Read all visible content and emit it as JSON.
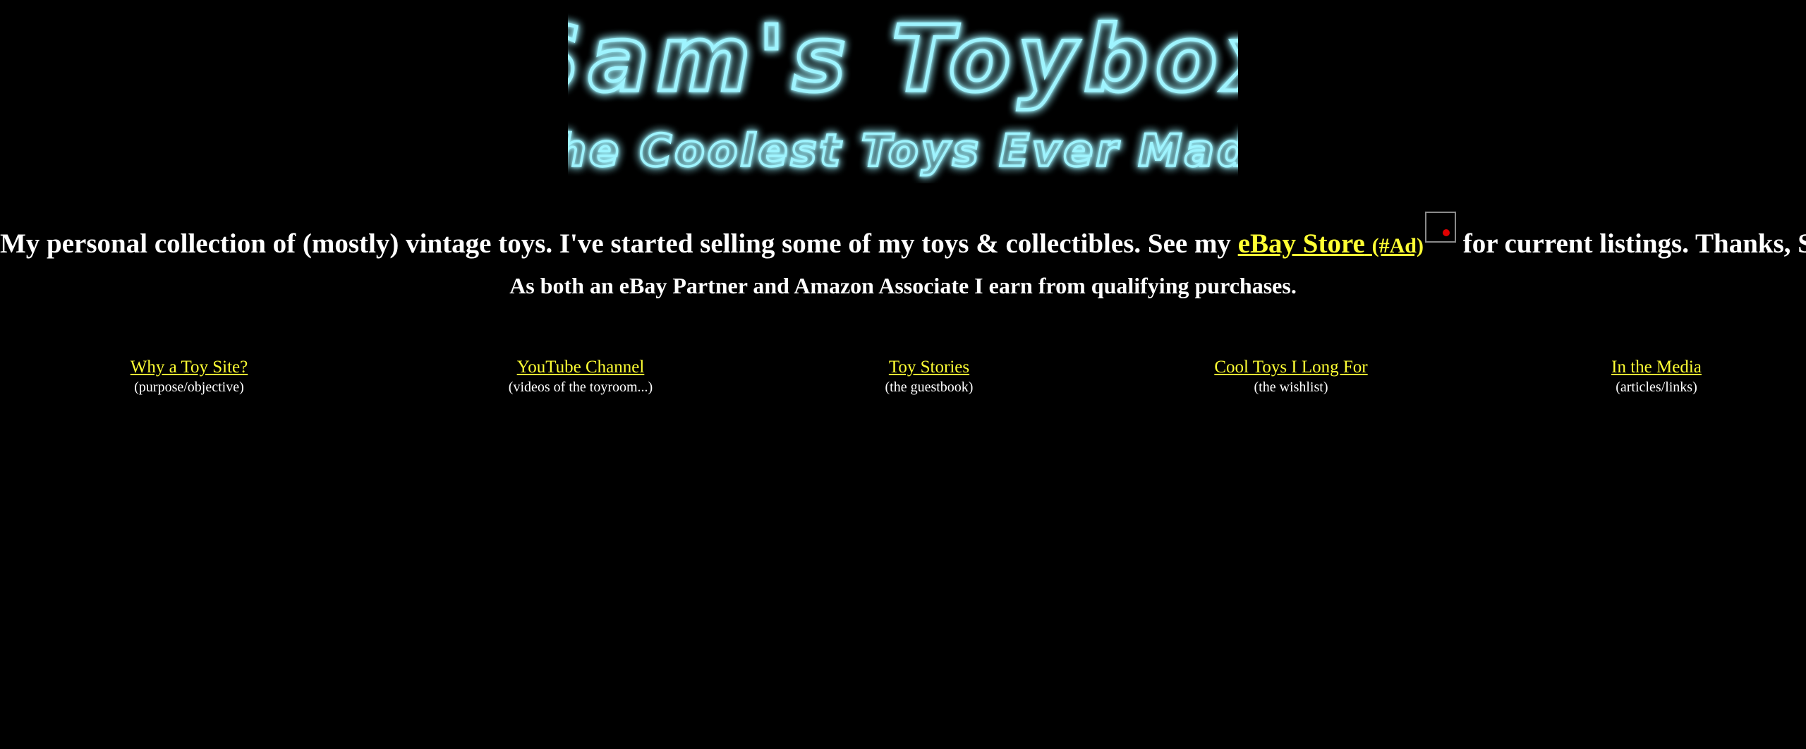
{
  "header": {
    "logo_title": "Sam's Toybox",
    "logo_subtitle": "The Coolest Toys Ever Made"
  },
  "intro": {
    "text_before": "My personal collection of (mostly) vintage toys. I've started selling some of my toys & collectibles. See my ",
    "ebay_link": "eBay Store",
    "ad_tag": "(#Ad)",
    "text_after": " for current listings. Thanks, Sam"
  },
  "disclosure": "As both an eBay Partner and Amazon Associate I earn from qualifying purchases.",
  "nav": [
    {
      "label": "Why a Toy Site?",
      "sub": "(purpose/objective)"
    },
    {
      "label": "YouTube Channel",
      "sub": "(videos of the toyroom...)"
    },
    {
      "label": "Toy Stories",
      "sub": "(the guestbook)"
    },
    {
      "label": "Cool Toys I Long For",
      "sub": "(the wishlist)"
    },
    {
      "label": "In the Media",
      "sub": "(articles/links)"
    }
  ],
  "colors": {
    "background": "#000000",
    "text": "#ffffff",
    "link": "#ffff33",
    "logo_neon": "#9ff4ff",
    "logo_glow": "#00c8e6"
  }
}
